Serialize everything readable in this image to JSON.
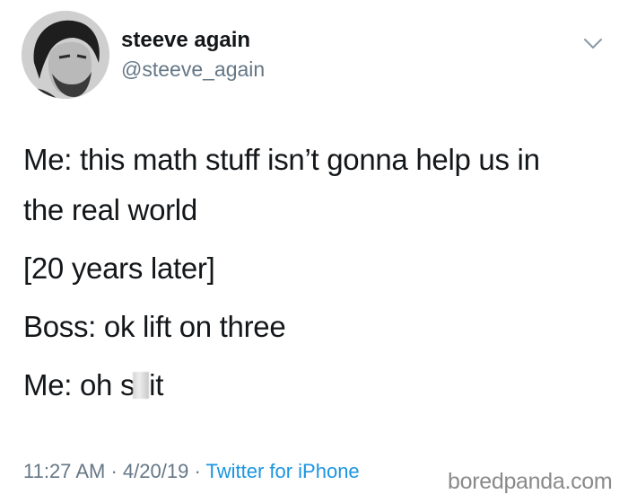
{
  "user": {
    "display_name": "steeve again",
    "handle": "@steeve_again"
  },
  "icons": {
    "avatar": "profile-photo",
    "menu": "chevron-down-icon"
  },
  "tweet": {
    "line_1": "Me: this math stuff isn’t gonna help us in",
    "line_2": "the real world",
    "line_3": "[20 years later]",
    "line_4": "Boss: ok lift on three",
    "line_5_before": "Me: oh s",
    "line_5_after": "it"
  },
  "meta": {
    "time": "11:27 AM",
    "separator": "·",
    "date": "4/20/19",
    "source": "Twitter for iPhone"
  },
  "watermark": "boredpanda.com",
  "colors": {
    "text": "#14171a",
    "secondary": "#657786",
    "link": "#1b95e0"
  }
}
